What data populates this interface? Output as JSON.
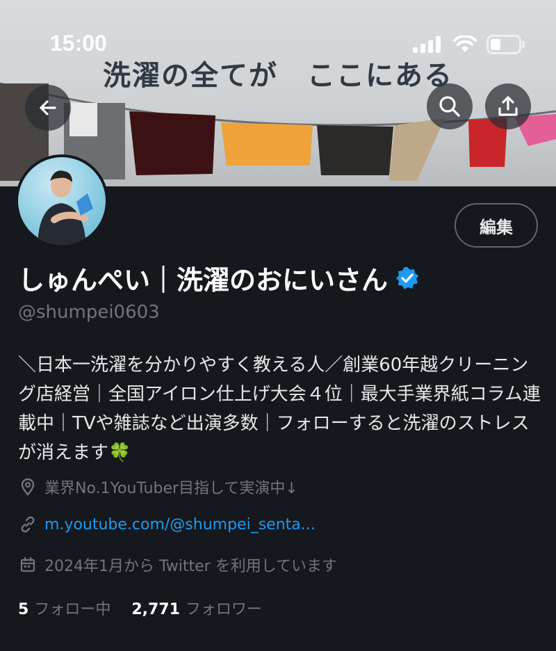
{
  "status_bar": {
    "time": "15:00"
  },
  "banner": {
    "title": "洗濯の全てが　ここにある"
  },
  "header_buttons": {
    "back": "arrow-left-icon",
    "search": "search-icon",
    "share": "share-icon"
  },
  "profile": {
    "name": "しゅんぺい｜洗濯のおにいさん",
    "handle": "@shumpei0603",
    "edit_label": "編集",
    "bio": "＼日本一洗濯を分かりやすく教える人／創業60年越クリーニング店経営｜全国アイロン仕上げ大会４位｜最大手業界紙コラム連載中｜TVや雑誌など出演多数｜フォローすると洗濯のストレスが消えます🍀",
    "location": "業界No.1YouTuber目指して実演中↓",
    "link": "m.youtube.com/@shumpei_senta...",
    "joined": "2024年1月から Twitter を利用しています",
    "following_count": "5",
    "following_label": "フォロー中",
    "followers_count": "2,771",
    "followers_label": "フォロワー"
  },
  "colors": {
    "background": "#15181d",
    "accent": "#1d9bf0",
    "muted": "#71767b",
    "verified": "#1d9bf0"
  }
}
